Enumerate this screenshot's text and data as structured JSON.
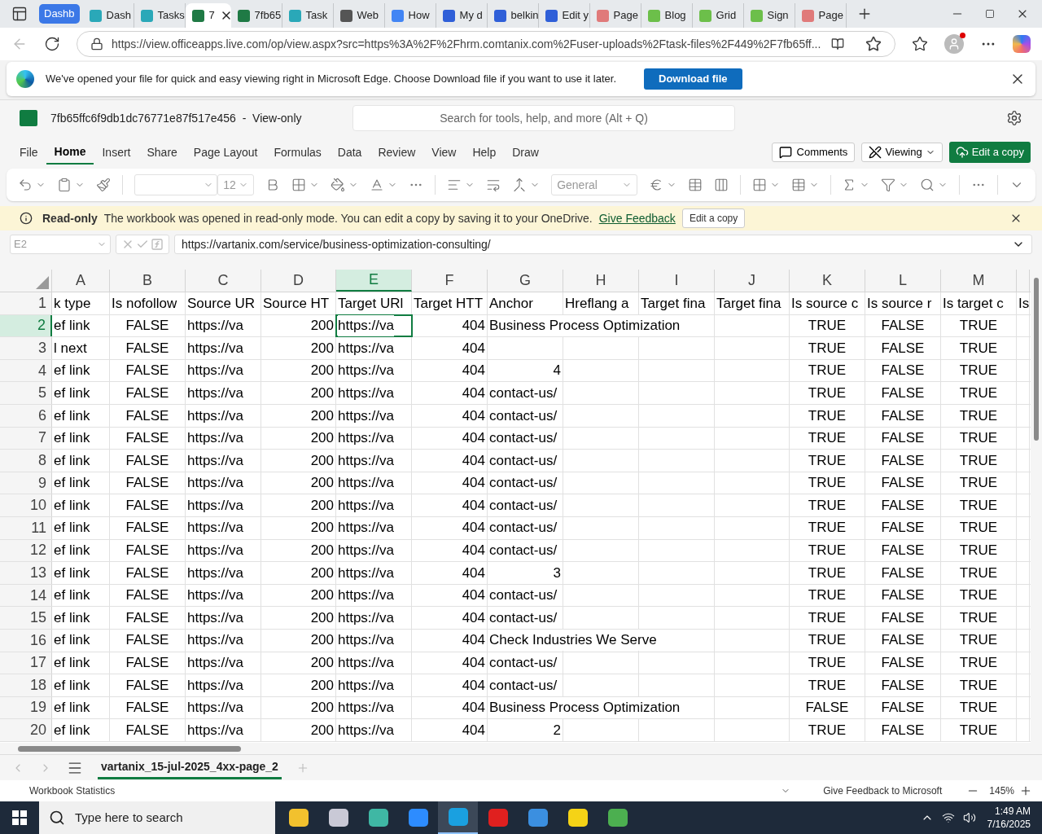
{
  "browser_tabs": [
    {
      "label": "Dashb",
      "kind": "group",
      "selected": false,
      "color": "#3b78e7"
    },
    {
      "label": "Dash",
      "kind": "tab",
      "selected": false,
      "color": "#2aa8b8"
    },
    {
      "label": "Tasks",
      "kind": "tab",
      "selected": false,
      "color": "#2aa8b8"
    },
    {
      "label": "7",
      "kind": "tab",
      "selected": true,
      "color": "#1f7a45"
    },
    {
      "label": "7fb65",
      "kind": "tab",
      "selected": false,
      "color": "#1f7a45"
    },
    {
      "label": "Task",
      "kind": "tab",
      "selected": false,
      "color": "#2aa8b8"
    },
    {
      "label": "Web",
      "kind": "tab",
      "selected": false,
      "color": "#555555"
    },
    {
      "label": "How",
      "kind": "tab",
      "selected": false,
      "color": "#4285f4"
    },
    {
      "label": "My d",
      "kind": "tab",
      "selected": false,
      "color": "#2f5fd8"
    },
    {
      "label": "belkin",
      "kind": "tab",
      "selected": false,
      "color": "#2f5fd8"
    },
    {
      "label": "Edit y",
      "kind": "tab",
      "selected": false,
      "color": "#2f5fd8"
    },
    {
      "label": "Page",
      "kind": "tab",
      "selected": false,
      "color": "#e07a7a"
    },
    {
      "label": "Blog",
      "kind": "tab",
      "selected": false,
      "color": "#6cbf4a"
    },
    {
      "label": "Grid",
      "kind": "tab",
      "selected": false,
      "color": "#6cbf4a"
    },
    {
      "label": "Sign",
      "kind": "tab",
      "selected": false,
      "color": "#6cbf4a"
    },
    {
      "label": "Page",
      "kind": "tab",
      "selected": false,
      "color": "#e07a7a"
    }
  ],
  "address": "https://view.officeapps.live.com/op/view.aspx?src=https%3A%2F%2Fhrm.comtanix.com%2Fuser-uploads%2Ftask-files%2F449%2F7fb65ff...",
  "info_bar": {
    "message": "We've opened your file for quick and easy viewing right in Microsoft Edge. Choose Download file if you want to use it later.",
    "button": "Download file"
  },
  "excel": {
    "file_title": "7fb65ffc6f9db1dc76771e87f517e456  -  View-only",
    "search_placeholder": "Search for tools, help, and more (Alt + Q)",
    "menu": [
      {
        "label": "File",
        "selected": false
      },
      {
        "label": "Home",
        "selected": true
      },
      {
        "label": "Insert",
        "selected": false
      },
      {
        "label": "Share",
        "selected": false
      },
      {
        "label": "Page Layout",
        "selected": false
      },
      {
        "label": "Formulas",
        "selected": false
      },
      {
        "label": "Data",
        "selected": false
      },
      {
        "label": "Review",
        "selected": false
      },
      {
        "label": "View",
        "selected": false
      },
      {
        "label": "Help",
        "selected": false
      },
      {
        "label": "Draw",
        "selected": false
      }
    ],
    "actions": {
      "comments": "Comments",
      "viewing": "Viewing",
      "edit_copy": "Edit a copy"
    },
    "ribbon": {
      "font_size": "12",
      "number_format": "General"
    },
    "readonly_bar": {
      "title": "Read-only",
      "message": "The workbook was opened in read-only mode. You can edit a copy by saving it to your OneDrive.",
      "link": "Give Feedback",
      "button": "Edit a copy"
    },
    "name_box": "E2",
    "formula": "https://vartanix.com/service/business-optimization-consulting/",
    "columns": [
      {
        "letter": "A",
        "kind": "text",
        "selected": false
      },
      {
        "letter": "B",
        "kind": "boolean",
        "selected": false
      },
      {
        "letter": "C",
        "kind": "text",
        "selected": false
      },
      {
        "letter": "D",
        "kind": "number",
        "selected": false
      },
      {
        "letter": "E",
        "kind": "text",
        "selected": true
      },
      {
        "letter": "F",
        "kind": "number",
        "selected": false
      },
      {
        "letter": "G",
        "kind": "text",
        "selected": false
      },
      {
        "letter": "H",
        "kind": "text",
        "selected": false
      },
      {
        "letter": "I",
        "kind": "text",
        "selected": false
      },
      {
        "letter": "J",
        "kind": "text",
        "selected": false
      },
      {
        "letter": "K",
        "kind": "boolean",
        "selected": false
      },
      {
        "letter": "L",
        "kind": "boolean",
        "selected": false
      },
      {
        "letter": "M",
        "kind": "boolean",
        "selected": false
      },
      {
        "kind": "text",
        "selected": false
      }
    ],
    "rows": [
      {
        "number": "1",
        "kind": "header",
        "selected": false,
        "cells": [
          "k type",
          "Is nofollow",
          "Source UR",
          "Source HT",
          "Target URl",
          "Target HTT",
          "Anchor",
          "Hreflang a",
          "Target fina",
          "Target fina",
          "Is source c",
          "Is source r",
          "Is target c",
          "Is"
        ]
      },
      {
        "number": "2",
        "kind": "data",
        "selected": true,
        "cells": [
          "ef link",
          "FALSE",
          "https://va",
          "200",
          "https://va",
          "404",
          "Business Process Optimization",
          null,
          null,
          null,
          "TRUE",
          "FALSE",
          "TRUE",
          null
        ]
      },
      {
        "number": "3",
        "kind": "data",
        "selected": false,
        "cells": [
          "l next",
          "FALSE",
          "https://va",
          "200",
          "https://va",
          "404",
          null,
          null,
          null,
          null,
          "TRUE",
          "FALSE",
          "TRUE",
          null
        ]
      },
      {
        "number": "4",
        "kind": "data",
        "selected": false,
        "anchor_numeric": true,
        "cells": [
          "ef link",
          "FALSE",
          "https://va",
          "200",
          "https://va",
          "404",
          "4",
          null,
          null,
          null,
          "TRUE",
          "FALSE",
          "TRUE",
          null
        ]
      },
      {
        "number": "5",
        "kind": "data",
        "selected": false,
        "cells": [
          "ef link",
          "FALSE",
          "https://va",
          "200",
          "https://va",
          "404",
          "contact-us/",
          null,
          null,
          null,
          "TRUE",
          "FALSE",
          "TRUE",
          null
        ]
      },
      {
        "number": "6",
        "kind": "data",
        "selected": false,
        "cells": [
          "ef link",
          "FALSE",
          "https://va",
          "200",
          "https://va",
          "404",
          "contact-us/",
          null,
          null,
          null,
          "TRUE",
          "FALSE",
          "TRUE",
          null
        ]
      },
      {
        "number": "7",
        "kind": "data",
        "selected": false,
        "cells": [
          "ef link",
          "FALSE",
          "https://va",
          "200",
          "https://va",
          "404",
          "contact-us/",
          null,
          null,
          null,
          "TRUE",
          "FALSE",
          "TRUE",
          null
        ]
      },
      {
        "number": "8",
        "kind": "data",
        "selected": false,
        "cells": [
          "ef link",
          "FALSE",
          "https://va",
          "200",
          "https://va",
          "404",
          "contact-us/",
          null,
          null,
          null,
          "TRUE",
          "FALSE",
          "TRUE",
          null
        ]
      },
      {
        "number": "9",
        "kind": "data",
        "selected": false,
        "cells": [
          "ef link",
          "FALSE",
          "https://va",
          "200",
          "https://va",
          "404",
          "contact-us/",
          null,
          null,
          null,
          "TRUE",
          "FALSE",
          "TRUE",
          null
        ]
      },
      {
        "number": "10",
        "kind": "data",
        "selected": false,
        "cells": [
          "ef link",
          "FALSE",
          "https://va",
          "200",
          "https://va",
          "404",
          "contact-us/",
          null,
          null,
          null,
          "TRUE",
          "FALSE",
          "TRUE",
          null
        ]
      },
      {
        "number": "11",
        "kind": "data",
        "selected": false,
        "cells": [
          "ef link",
          "FALSE",
          "https://va",
          "200",
          "https://va",
          "404",
          "contact-us/",
          null,
          null,
          null,
          "TRUE",
          "FALSE",
          "TRUE",
          null
        ]
      },
      {
        "number": "12",
        "kind": "data",
        "selected": false,
        "cells": [
          "ef link",
          "FALSE",
          "https://va",
          "200",
          "https://va",
          "404",
          "contact-us/",
          null,
          null,
          null,
          "TRUE",
          "FALSE",
          "TRUE",
          null
        ]
      },
      {
        "number": "13",
        "kind": "data",
        "selected": false,
        "anchor_numeric": true,
        "cells": [
          "ef link",
          "FALSE",
          "https://va",
          "200",
          "https://va",
          "404",
          "3",
          null,
          null,
          null,
          "TRUE",
          "FALSE",
          "TRUE",
          null
        ]
      },
      {
        "number": "14",
        "kind": "data",
        "selected": false,
        "cells": [
          "ef link",
          "FALSE",
          "https://va",
          "200",
          "https://va",
          "404",
          "contact-us/",
          null,
          null,
          null,
          "TRUE",
          "FALSE",
          "TRUE",
          null
        ]
      },
      {
        "number": "15",
        "kind": "data",
        "selected": false,
        "cells": [
          "ef link",
          "FALSE",
          "https://va",
          "200",
          "https://va",
          "404",
          "contact-us/",
          null,
          null,
          null,
          "TRUE",
          "FALSE",
          "TRUE",
          null
        ]
      },
      {
        "number": "16",
        "kind": "data",
        "selected": false,
        "cells": [
          "ef link",
          "FALSE",
          "https://va",
          "200",
          "https://va",
          "404",
          "Check Industries We Serve",
          null,
          null,
          null,
          "TRUE",
          "FALSE",
          "TRUE",
          null
        ]
      },
      {
        "number": "17",
        "kind": "data",
        "selected": false,
        "cells": [
          "ef link",
          "FALSE",
          "https://va",
          "200",
          "https://va",
          "404",
          "contact-us/",
          null,
          null,
          null,
          "TRUE",
          "FALSE",
          "TRUE",
          null
        ]
      },
      {
        "number": "18",
        "kind": "data",
        "selected": false,
        "cells": [
          "ef link",
          "FALSE",
          "https://va",
          "200",
          "https://va",
          "404",
          "contact-us/",
          null,
          null,
          null,
          "TRUE",
          "FALSE",
          "TRUE",
          null
        ]
      },
      {
        "number": "19",
        "kind": "data",
        "selected": false,
        "cells": [
          "ef link",
          "FALSE",
          "https://va",
          "200",
          "https://va",
          "404",
          "Business Process Optimization",
          null,
          null,
          null,
          "FALSE",
          "FALSE",
          "TRUE",
          null
        ]
      },
      {
        "number": "20",
        "kind": "data",
        "selected": false,
        "anchor_numeric": true,
        "cells": [
          "ef link",
          "FALSE",
          "https://va",
          "200",
          "https://va",
          "404",
          "2",
          null,
          null,
          null,
          "TRUE",
          "FALSE",
          "TRUE",
          null
        ]
      }
    ],
    "sheet_tab": "vartanix_15-jul-2025_4xx-page_2",
    "status": {
      "left": "Workbook Statistics",
      "feedback": "Give Feedback to Microsoft",
      "zoom": "145%"
    }
  },
  "taskbar": {
    "search_placeholder": "Type here to search",
    "apps": [
      {
        "color": "#f2c12e",
        "selected": false
      },
      {
        "color": "#c9c9d6",
        "selected": false
      },
      {
        "color": "#3fb7a4",
        "selected": false
      },
      {
        "color": "#2d8cff",
        "selected": false
      },
      {
        "color": "#1aa0e0",
        "selected": true
      },
      {
        "color": "#e0201f",
        "selected": false
      },
      {
        "color": "#3b8fe0",
        "selected": false
      },
      {
        "color": "#f5d316",
        "selected": false
      },
      {
        "color": "#4caf50",
        "selected": false
      }
    ],
    "time": "1:49 AM",
    "date": "7/16/2025"
  }
}
